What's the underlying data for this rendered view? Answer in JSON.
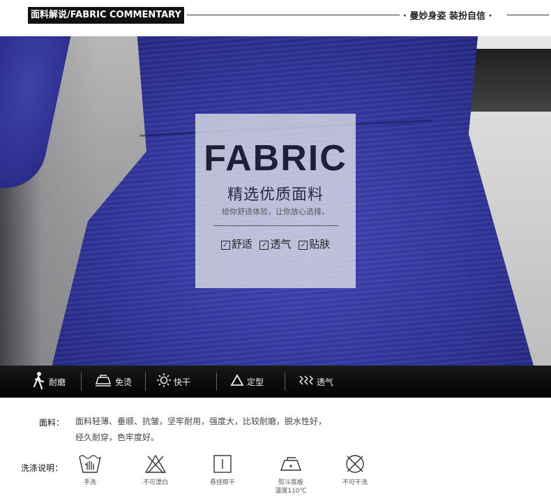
{
  "header": {
    "tag": "面料解说/FABRIC COMMENTARY",
    "slogan": "· 曼妙身姿 装扮自信 ·"
  },
  "panel": {
    "big_title": "FABRIC",
    "subtitle": "精选优质面料",
    "tagline": "给你舒适体验，让你放心选择。",
    "checks": [
      {
        "mark": "✓",
        "label": "舒适"
      },
      {
        "mark": "✓",
        "label": "透气"
      },
      {
        "mark": "✓",
        "label": "贴肤"
      }
    ]
  },
  "features": [
    {
      "icon": "person-walking-icon",
      "label": "耐磨"
    },
    {
      "icon": "iron-icon",
      "label": "免烫"
    },
    {
      "icon": "sun-icon",
      "label": "快干"
    },
    {
      "icon": "triangle-icon",
      "label": "定型"
    },
    {
      "icon": "wave-icon",
      "label": "透气"
    }
  ],
  "fabric_info": {
    "label": "面料：",
    "line1": "面料轻薄、垂顺、抗皱，坚牢耐用，强度大，比较耐磨，脱水性好，",
    "line2": "经久耐穿，色牢度好。"
  },
  "care": {
    "label": "洗涤说明：",
    "items": [
      {
        "icon": "hand-wash-icon",
        "caption": "手洗"
      },
      {
        "icon": "no-bleach-icon",
        "caption": "不可漂白"
      },
      {
        "icon": "hang-dry-icon",
        "caption": "悬挂晾干"
      },
      {
        "icon": "iron-temp-icon",
        "caption": "熨斗底板",
        "caption2": "温度110℃"
      },
      {
        "icon": "no-dry-clean-icon",
        "caption": "不可干洗"
      }
    ]
  }
}
